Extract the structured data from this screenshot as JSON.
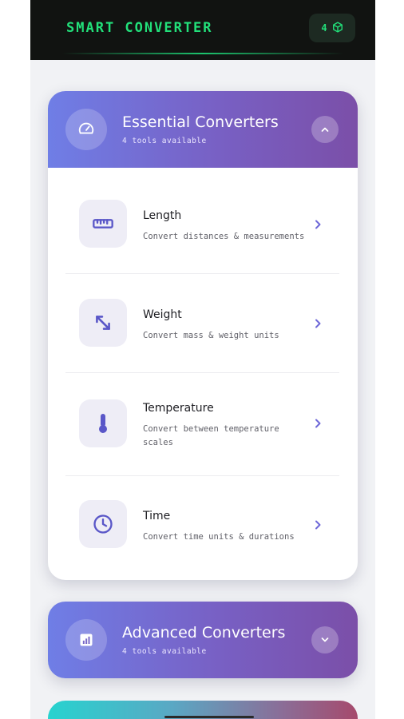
{
  "app": {
    "title": "SMART CONVERTER",
    "badge_count": "4",
    "badge_icon": "cube-icon",
    "accent": "#22e07a"
  },
  "sections": [
    {
      "title": "Essential Converters",
      "subtitle": "4 tools available",
      "icon": "speedometer-icon",
      "toggle_icon": "chevron-up-icon",
      "expanded": true,
      "tools": [
        {
          "name": "Length",
          "desc": "Convert distances & measurements",
          "icon": "ruler-icon",
          "color": "#5a57c8"
        },
        {
          "name": "Weight",
          "desc": "Convert mass & weight units",
          "icon": "resize-arrows-icon",
          "color": "#5a57c8"
        },
        {
          "name": "Temperature",
          "desc": "Convert between temperature scales",
          "icon": "thermometer-icon",
          "color": "#5a57c8"
        },
        {
          "name": "Time",
          "desc": "Convert time units & durations",
          "icon": "clock-icon",
          "color": "#5a57c8"
        }
      ]
    },
    {
      "title": "Advanced Converters",
      "subtitle": "4 tools available",
      "icon": "bar-chart-icon",
      "toggle_icon": "chevron-down-icon",
      "expanded": false
    }
  ],
  "colors": {
    "header_gradient_start": "#6f7ee6",
    "header_gradient_end": "#7b4fa8",
    "tool_icon_bg": "#eeedf6",
    "third_card_gradient_start": "#27d3cf",
    "third_card_gradient_end": "#a64a6c"
  }
}
